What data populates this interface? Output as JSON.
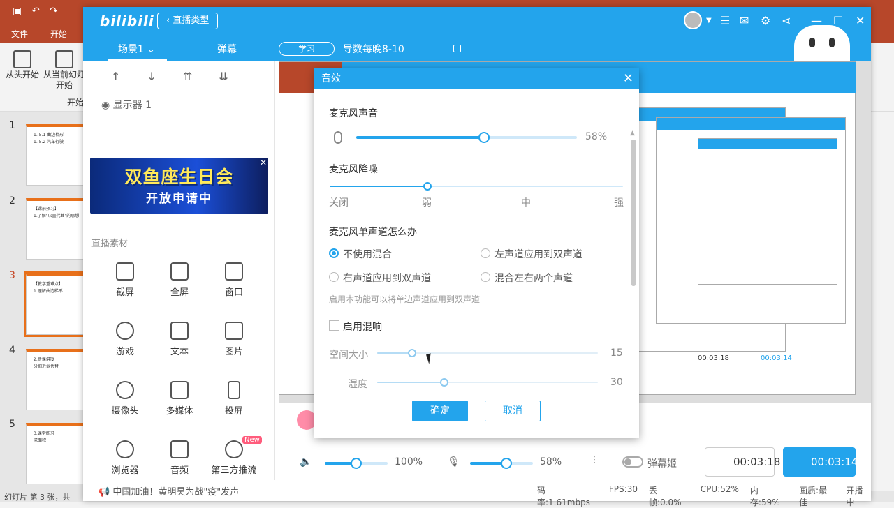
{
  "ppt": {
    "tabs": [
      "文件",
      "开始"
    ],
    "ribbon": {
      "btn1": "从头开始",
      "btn2_line1": "从当前幻灯",
      "btn2_line2": "开始",
      "group": "开始"
    },
    "slides": [
      {
        "num": "1",
        "text1": "1. 5.1 曲边梯形",
        "text2": "1. 5.2 汽车行驶"
      },
      {
        "num": "2",
        "text1": "【课前预习】",
        "text2": "1.了解\"以直代曲\"的思想"
      },
      {
        "num": "3",
        "text1": "【教学重难点】",
        "text2": "1.理解曲边梯形"
      },
      {
        "num": "4",
        "text1": "2.新课讲授",
        "text2": "分割近似代替"
      },
      {
        "num": "5",
        "text1": "3.课堂练习",
        "text2": "求面积"
      }
    ],
    "status": "幻灯片 第 3 张，共"
  },
  "bili": {
    "logo": "bilibili",
    "type_button": "直播类型",
    "scene_tab": "场景1",
    "danmu_tab": "弹幕",
    "category": "学习",
    "room_title": "导数每晚8-10",
    "display_source": "显示器 1",
    "banner_line1": "双鱼座生日会",
    "banner_line2": "开放申请中",
    "material_title": "直播素材",
    "tools": [
      {
        "label": "截屏",
        "icon": "crop-icon"
      },
      {
        "label": "全屏",
        "icon": "monitor-icon"
      },
      {
        "label": "窗口",
        "icon": "window-icon"
      },
      {
        "label": "游戏",
        "icon": "gamepad-icon"
      },
      {
        "label": "文本",
        "icon": "text-icon"
      },
      {
        "label": "图片",
        "icon": "image-icon"
      },
      {
        "label": "摄像头",
        "icon": "camera-icon"
      },
      {
        "label": "多媒体",
        "icon": "media-icon"
      },
      {
        "label": "投屏",
        "icon": "phone-icon"
      },
      {
        "label": "浏览器",
        "icon": "browser-icon"
      },
      {
        "label": "音频",
        "icon": "music-icon"
      },
      {
        "label": "第三方推流",
        "icon": "stream-icon",
        "badge": "New"
      }
    ],
    "footer_news": "中国加油！黄明昊为战\"疫\"发声",
    "volume": {
      "speaker": "100%",
      "speaker_value": 0.5,
      "mic": "58%",
      "mic_value": 0.58
    },
    "danmaku_ji": "弹幕姬",
    "timer_record": "00:03:18",
    "timer_live": "00:03:14",
    "stats": {
      "bitrate": "码率:1.61mbps",
      "fps": "FPS:30",
      "drop": "丢帧:0.0%",
      "cpu": "CPU:52%",
      "mem": "内存:59%",
      "quality": "画质:最佳",
      "live": "开播中"
    }
  },
  "dialog": {
    "title": "音效",
    "mic_volume_label": "麦克风声音",
    "mic_volume_value": "58%",
    "mic_volume": 0.58,
    "noise_label": "麦克风降噪",
    "noise_levels": [
      "关闭",
      "弱",
      "中",
      "强"
    ],
    "noise_selected": "弱",
    "mono_label": "麦克风单声道怎么办",
    "mono_options": [
      "不使用混合",
      "左声道应用到双声道",
      "右声道应用到双声道",
      "混合左右两个声道"
    ],
    "mono_selected": "不使用混合",
    "hint": "启用本功能可以将单边声道应用到双声道",
    "reverb_label": "启用混响",
    "reverb_enabled": false,
    "room_size_label": "空间大小",
    "room_size_value": "15",
    "humidity_label": "湿度",
    "humidity_value": "30",
    "ok": "确定",
    "cancel": "取消"
  },
  "colors": {
    "accent": "#23a4ec",
    "ppt": "#b7472a",
    "slide_accent": "#e8701a"
  }
}
